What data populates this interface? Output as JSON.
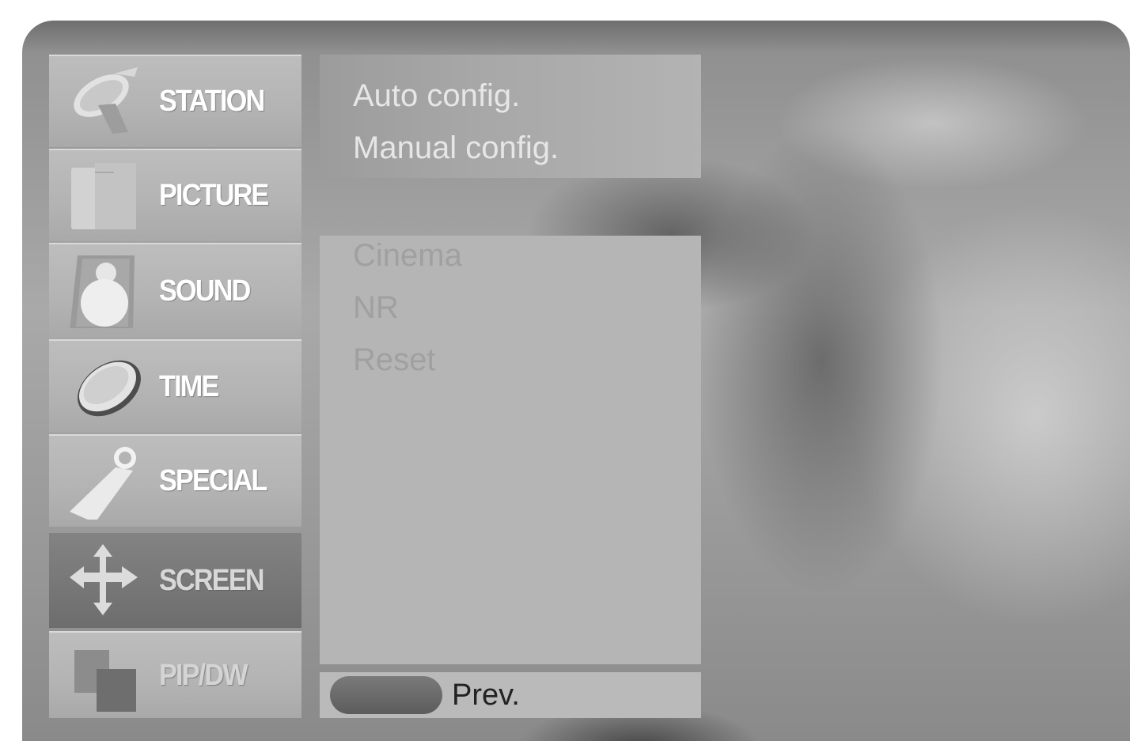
{
  "menu": {
    "items": [
      {
        "label": "STATION",
        "icon": "satellite-dish-icon"
      },
      {
        "label": "PICTURE",
        "icon": "picture-frame-icon"
      },
      {
        "label": "SOUND",
        "icon": "speaker-icon"
      },
      {
        "label": "TIME",
        "icon": "clock-icon"
      },
      {
        "label": "SPECIAL",
        "icon": "tag-icon"
      },
      {
        "label": "SCREEN",
        "icon": "move-arrows-icon",
        "selected": true
      },
      {
        "label": "PIP/DW",
        "icon": "pip-windows-icon"
      }
    ]
  },
  "submenu": {
    "top_items": [
      "Auto config.",
      "Manual config."
    ],
    "bottom_items": [
      "Cinema",
      "NR",
      "Reset"
    ]
  },
  "footer": {
    "prev_label": "Prev."
  }
}
